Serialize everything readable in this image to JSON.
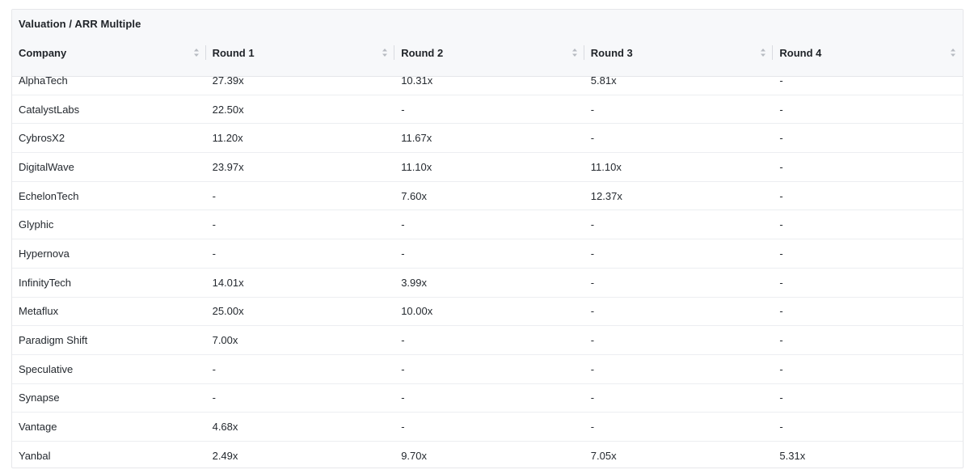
{
  "table": {
    "title": "Valuation / ARR Multiple",
    "columns": [
      "Company",
      "Round 1",
      "Round 2",
      "Round 3",
      "Round 4"
    ],
    "rows": [
      [
        "AlphaTech",
        "27.39x",
        "10.31x",
        "5.81x",
        "-"
      ],
      [
        "CatalystLabs",
        "22.50x",
        "-",
        "-",
        "-"
      ],
      [
        "CybrosX2",
        "11.20x",
        "11.67x",
        "-",
        "-"
      ],
      [
        "DigitalWave",
        "23.97x",
        "11.10x",
        "11.10x",
        "-"
      ],
      [
        "EchelonTech",
        "-",
        "7.60x",
        "12.37x",
        "-"
      ],
      [
        "Glyphic",
        "-",
        "-",
        "-",
        "-"
      ],
      [
        "Hypernova",
        "-",
        "-",
        "-",
        "-"
      ],
      [
        "InfinityTech",
        "14.01x",
        "3.99x",
        "-",
        "-"
      ],
      [
        "Metaflux",
        "25.00x",
        "10.00x",
        "-",
        "-"
      ],
      [
        "Paradigm Shift",
        "7.00x",
        "-",
        "-",
        "-"
      ],
      [
        "Speculative",
        "-",
        "-",
        "-",
        "-"
      ],
      [
        "Synapse",
        "-",
        "-",
        "-",
        "-"
      ],
      [
        "Vantage",
        "4.68x",
        "-",
        "-",
        "-"
      ],
      [
        "Yanbal",
        "2.49x",
        "9.70x",
        "7.05x",
        "5.31x"
      ]
    ]
  },
  "icons": {
    "sort": "sort-icon"
  },
  "colors": {
    "header_bg": "#f7f8fa",
    "border": "#e6e7ea",
    "text": "#1f2328",
    "icon": "#b7bbc2"
  }
}
